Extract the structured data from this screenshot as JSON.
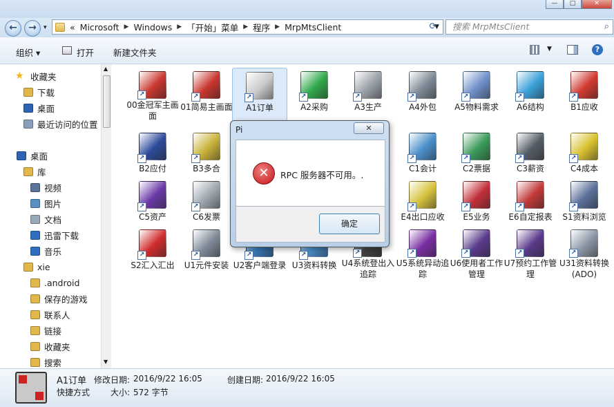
{
  "window": {
    "caption_buttons": [
      "—",
      "□",
      "✕"
    ]
  },
  "nav": {
    "back_icon": "back-arrow-icon",
    "forward_icon": "forward-arrow-icon",
    "history_dropdown": "▾"
  },
  "address": {
    "lead": "«",
    "crumbs": [
      "Microsoft",
      "Windows",
      "「开始」菜单",
      "程序",
      "MrpMtsClient"
    ]
  },
  "search": {
    "placeholder": "搜索 MrpMtsClient"
  },
  "toolbar": {
    "organize": "组织 ▾",
    "open": "打开",
    "new_folder": "新建文件夹"
  },
  "sidebar": {
    "items": [
      {
        "label": "收藏夹",
        "icon": "star-icon",
        "color": "#f1b422"
      },
      {
        "label": "下载",
        "icon": "folder-icon",
        "color": "#e3b84b"
      },
      {
        "label": "桌面",
        "icon": "monitor-icon",
        "color": "#2d63b3"
      },
      {
        "label": "最近访问的位置",
        "icon": "recent-places-icon",
        "color": "#8aa0ba"
      },
      {
        "label": "桌面",
        "icon": "monitor-icon",
        "color": "#2d63b3"
      },
      {
        "label": "库",
        "icon": "folder-icon",
        "color": "#e3b84b"
      },
      {
        "label": "视频",
        "icon": "video-icon",
        "color": "#5a7398"
      },
      {
        "label": "图片",
        "icon": "picture-icon",
        "color": "#5a8fc4"
      },
      {
        "label": "文档",
        "icon": "document-icon",
        "color": "#9aa9ba"
      },
      {
        "label": "迅雷下载",
        "icon": "thunder-icon",
        "color": "#2f6fc0"
      },
      {
        "label": "音乐",
        "icon": "music-icon",
        "color": "#2f6fc0"
      },
      {
        "label": "xie",
        "icon": "user-folder-icon",
        "color": "#e3b84b"
      },
      {
        "label": ".android",
        "icon": "folder-icon",
        "color": "#e3b84b"
      },
      {
        "label": "保存的游戏",
        "icon": "folder-icon",
        "color": "#e3b84b"
      },
      {
        "label": "联系人",
        "icon": "folder-icon",
        "color": "#e3b84b"
      },
      {
        "label": "链接",
        "icon": "folder-icon",
        "color": "#e3b84b"
      },
      {
        "label": "收藏夹",
        "icon": "folder-icon",
        "color": "#e3b84b"
      },
      {
        "label": "搜索",
        "icon": "folder-icon",
        "color": "#e3b84b"
      }
    ]
  },
  "files": [
    {
      "label": "00金冠军主画面",
      "icon": "atc-logo-icon",
      "color": "#c8362e",
      "selected": false
    },
    {
      "label": "01简易主画面",
      "icon": "atc-logo-icon",
      "color": "#c8362e",
      "selected": false
    },
    {
      "label": "A1订单",
      "icon": "order-icon",
      "color": "#c9c9c9",
      "selected": true
    },
    {
      "label": "A2采购",
      "icon": "purchase-icon",
      "color": "#2fa84a",
      "selected": false
    },
    {
      "label": "A3生产",
      "icon": "production-icon",
      "color": "#9aa0a8",
      "selected": false
    },
    {
      "label": "A4外包",
      "icon": "outsource-icon",
      "color": "#7d8a96",
      "selected": false
    },
    {
      "label": "A5物料需求",
      "icon": "material-icon",
      "color": "#6e8fc8",
      "selected": false
    },
    {
      "label": "A6结构",
      "icon": "structure-icon",
      "color": "#3aa0d8",
      "selected": false
    },
    {
      "label": "B1应收",
      "icon": "receivable-icon",
      "color": "#d03a2f",
      "selected": false
    },
    {
      "label": "B2应付",
      "icon": "payable-icon",
      "color": "#2c4a9a",
      "selected": false
    },
    {
      "label": "B3多合",
      "icon": "binder-icon",
      "color": "#c9b23a",
      "selected": false
    },
    {
      "label": "C1会计",
      "icon": "accounting-icon",
      "color": "#4a8fc9",
      "selected": false
    },
    {
      "label": "C2票据",
      "icon": "bill-icon",
      "color": "#3a9a5a",
      "selected": false
    },
    {
      "label": "C3薪资",
      "icon": "salary-icon",
      "color": "#555d66",
      "selected": false
    },
    {
      "label": "C4成本",
      "icon": "cost-icon",
      "color": "#d9c12f",
      "selected": false
    },
    {
      "label": "C5资产",
      "icon": "asset-icon",
      "color": "#6a3aa8",
      "selected": false
    },
    {
      "label": "C6发票",
      "icon": "invoice-icon",
      "color": "#9ea7b0",
      "selected": false
    },
    {
      "label": "E4出口应收",
      "icon": "export-icon",
      "color": "#d7c23e",
      "selected": false
    },
    {
      "label": "E5业务",
      "icon": "business-icon",
      "color": "#c2303a",
      "selected": false
    },
    {
      "label": "E6自定报表",
      "icon": "report-icon",
      "color": "#c23a3a",
      "selected": false
    },
    {
      "label": "S1资料浏览",
      "icon": "browse-icon",
      "color": "#5a6f9a",
      "selected": false
    },
    {
      "label": "S2汇入汇出",
      "icon": "import-export-icon",
      "color": "#d02c2c",
      "selected": false
    },
    {
      "label": "U1元件安装",
      "icon": "install-icon",
      "color": "#7f8a99",
      "selected": false
    },
    {
      "label": "U2客户端登录",
      "icon": "client-login-icon",
      "color": "#3a7fc0",
      "selected": false
    },
    {
      "label": "U3资料转换",
      "icon": "convert-icon",
      "color": "#4a90d0",
      "selected": false
    },
    {
      "label": "U4系统登出入追踪",
      "icon": "trace-icon",
      "color": "#444444",
      "selected": false
    },
    {
      "label": "U5系统异动追踪",
      "icon": "change-trace-icon",
      "color": "#7a2fa3",
      "selected": false
    },
    {
      "label": "U6使用者工作管理",
      "icon": "user-work-icon",
      "color": "#5a3a8a",
      "selected": false
    },
    {
      "label": "U7预约工作管理",
      "icon": "schedule-icon",
      "color": "#5a3a8a",
      "selected": false
    },
    {
      "label": "U31资料转换(ADO)",
      "icon": "ado-convert-icon",
      "color": "#8a96a6",
      "selected": false
    }
  ],
  "dialog": {
    "title": "Pi",
    "close": "✕",
    "message": "RPC 服务器不可用。.",
    "ok": "确定"
  },
  "details": {
    "name": "A1订单",
    "type": "快捷方式",
    "modified_label": "修改日期:",
    "modified": "2016/9/22 16:05",
    "created_label": "创建日期:",
    "created": "2016/9/22 16:05",
    "size_label": "大小:",
    "size": "572 字节"
  },
  "colors": {
    "accent": "#2d63b3",
    "selection": "#dbe9f9",
    "error": "#c3151b"
  }
}
